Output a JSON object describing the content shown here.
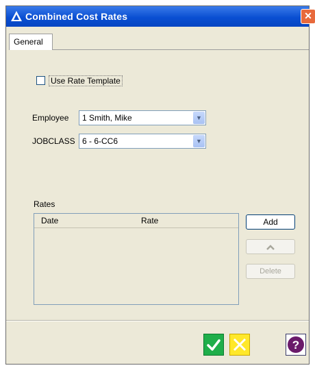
{
  "window": {
    "title": "Combined Cost Rates",
    "close_glyph": "✕"
  },
  "tabs": [
    {
      "label": "General"
    }
  ],
  "form": {
    "use_rate_template_label": "Use Rate Template",
    "use_rate_template_checked": false,
    "employee": {
      "label": "Employee",
      "value": "1 Smith, Mike"
    },
    "jobclass": {
      "label": "JOBCLASS",
      "value": "6 - 6-CC6"
    }
  },
  "rates": {
    "label": "Rates",
    "columns": [
      "Date",
      "Rate"
    ],
    "rows": [],
    "buttons": {
      "add": "Add",
      "up": "^",
      "delete": "Delete"
    }
  },
  "footer": {
    "ok_icon": "checkmark-icon",
    "cancel_icon": "x-icon",
    "help_icon": "question-icon"
  },
  "colors": {
    "titlebar": "#0a4fd2",
    "ok": "#1fae4a",
    "cancel": "#ffe82a",
    "help": "#6a1a6a"
  }
}
